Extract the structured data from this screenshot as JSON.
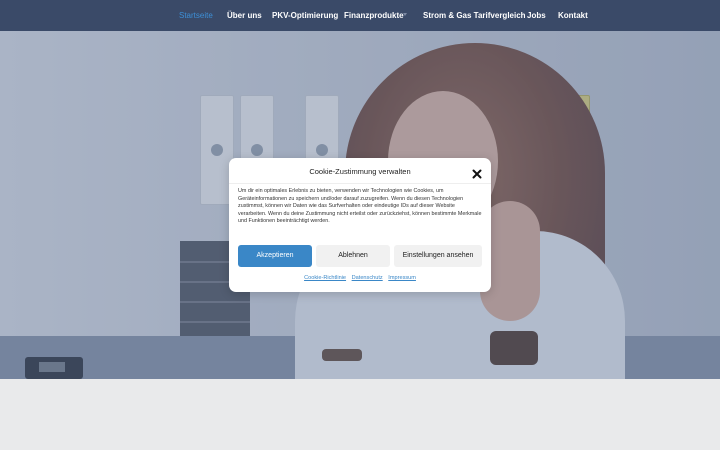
{
  "nav": {
    "items": [
      {
        "label": "Startseite",
        "active": true
      },
      {
        "label": "Über uns"
      },
      {
        "label": "PKV-Optimierung"
      },
      {
        "label": "Finanzprodukte",
        "has_dropdown": true
      },
      {
        "label": "Strom & Gas Tarifvergleich"
      },
      {
        "label": "Jobs"
      },
      {
        "label": "Kontakt"
      }
    ],
    "colors": {
      "background": "#3a4a68",
      "active": "#3d8fd6",
      "text": "#ffffff"
    }
  },
  "hero": {
    "image": "office-woman-thumbs-up"
  },
  "cookie_modal": {
    "title": "Cookie-Zustimmung verwalten",
    "close_icon": "close-icon",
    "text": "Um dir ein optimales Erlebnis zu bieten, verwenden wir Technologien wie Cookies, um Geräteinformationen zu speichern und/oder darauf zuzugreifen. Wenn du diesen Technologien zustimmst, können wir Daten wie das Surfverhalten oder eindeutige IDs auf dieser Website verarbeiten. Wenn du deine Zustimmung nicht erteilst oder zurückziehst, können bestimmte Merkmale und Funktionen beeinträchtigt werden.",
    "buttons": {
      "accept": "Akzeptieren",
      "decline": "Ablehnen",
      "settings": "Einstellungen ansehen"
    },
    "links": {
      "cookie_policy": "Cookie-Richtlinie",
      "privacy": "Datenschutz",
      "imprint": "Impressum"
    },
    "accent_color": "#3a87c7"
  }
}
